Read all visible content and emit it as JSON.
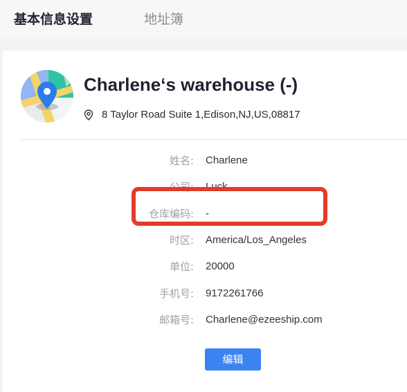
{
  "tabs": [
    {
      "label": "基本信息设置",
      "active": true
    },
    {
      "label": "地址簿",
      "active": false
    }
  ],
  "warehouse": {
    "icon": "map-location-icon",
    "name": "Charlene‘s warehouse (-)",
    "address_icon": "location-pin-icon",
    "address": "8 Taylor Road Suite 1,Edison,NJ,US,08817"
  },
  "fields": [
    {
      "label": "姓名:",
      "value": "Charlene"
    },
    {
      "label": "公司:",
      "value": "Luck"
    },
    {
      "label": "仓库编码:",
      "value": "-"
    },
    {
      "label": "时区:",
      "value": "America/Los_Angeles"
    },
    {
      "label": "单位:",
      "value": "20000"
    },
    {
      "label": "手机号:",
      "value": "9172261766"
    },
    {
      "label": "邮箱号:",
      "value": "Charlene@ezeeship.com"
    }
  ],
  "edit_button": {
    "label": "编辑"
  },
  "colors": {
    "accent": "#3c82f0",
    "highlight": "#e33a2a",
    "title": "#1f2233",
    "label": "#a0a0a0"
  }
}
